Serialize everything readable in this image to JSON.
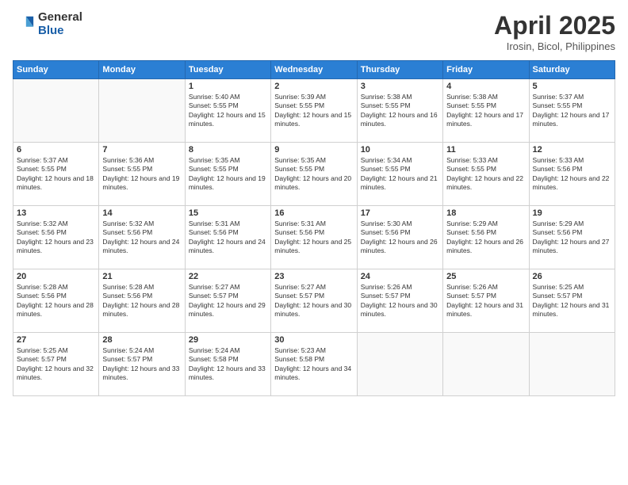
{
  "header": {
    "logo": {
      "general": "General",
      "blue": "Blue"
    },
    "title": "April 2025",
    "location": "Irosin, Bicol, Philippines"
  },
  "weekdays": [
    "Sunday",
    "Monday",
    "Tuesday",
    "Wednesday",
    "Thursday",
    "Friday",
    "Saturday"
  ],
  "weeks": [
    [
      {
        "day": null
      },
      {
        "day": null
      },
      {
        "day": "1",
        "sunrise": "Sunrise: 5:40 AM",
        "sunset": "Sunset: 5:55 PM",
        "daylight": "Daylight: 12 hours and 15 minutes."
      },
      {
        "day": "2",
        "sunrise": "Sunrise: 5:39 AM",
        "sunset": "Sunset: 5:55 PM",
        "daylight": "Daylight: 12 hours and 15 minutes."
      },
      {
        "day": "3",
        "sunrise": "Sunrise: 5:38 AM",
        "sunset": "Sunset: 5:55 PM",
        "daylight": "Daylight: 12 hours and 16 minutes."
      },
      {
        "day": "4",
        "sunrise": "Sunrise: 5:38 AM",
        "sunset": "Sunset: 5:55 PM",
        "daylight": "Daylight: 12 hours and 17 minutes."
      },
      {
        "day": "5",
        "sunrise": "Sunrise: 5:37 AM",
        "sunset": "Sunset: 5:55 PM",
        "daylight": "Daylight: 12 hours and 17 minutes."
      }
    ],
    [
      {
        "day": "6",
        "sunrise": "Sunrise: 5:37 AM",
        "sunset": "Sunset: 5:55 PM",
        "daylight": "Daylight: 12 hours and 18 minutes."
      },
      {
        "day": "7",
        "sunrise": "Sunrise: 5:36 AM",
        "sunset": "Sunset: 5:55 PM",
        "daylight": "Daylight: 12 hours and 19 minutes."
      },
      {
        "day": "8",
        "sunrise": "Sunrise: 5:35 AM",
        "sunset": "Sunset: 5:55 PM",
        "daylight": "Daylight: 12 hours and 19 minutes."
      },
      {
        "day": "9",
        "sunrise": "Sunrise: 5:35 AM",
        "sunset": "Sunset: 5:55 PM",
        "daylight": "Daylight: 12 hours and 20 minutes."
      },
      {
        "day": "10",
        "sunrise": "Sunrise: 5:34 AM",
        "sunset": "Sunset: 5:55 PM",
        "daylight": "Daylight: 12 hours and 21 minutes."
      },
      {
        "day": "11",
        "sunrise": "Sunrise: 5:33 AM",
        "sunset": "Sunset: 5:55 PM",
        "daylight": "Daylight: 12 hours and 22 minutes."
      },
      {
        "day": "12",
        "sunrise": "Sunrise: 5:33 AM",
        "sunset": "Sunset: 5:56 PM",
        "daylight": "Daylight: 12 hours and 22 minutes."
      }
    ],
    [
      {
        "day": "13",
        "sunrise": "Sunrise: 5:32 AM",
        "sunset": "Sunset: 5:56 PM",
        "daylight": "Daylight: 12 hours and 23 minutes."
      },
      {
        "day": "14",
        "sunrise": "Sunrise: 5:32 AM",
        "sunset": "Sunset: 5:56 PM",
        "daylight": "Daylight: 12 hours and 24 minutes."
      },
      {
        "day": "15",
        "sunrise": "Sunrise: 5:31 AM",
        "sunset": "Sunset: 5:56 PM",
        "daylight": "Daylight: 12 hours and 24 minutes."
      },
      {
        "day": "16",
        "sunrise": "Sunrise: 5:31 AM",
        "sunset": "Sunset: 5:56 PM",
        "daylight": "Daylight: 12 hours and 25 minutes."
      },
      {
        "day": "17",
        "sunrise": "Sunrise: 5:30 AM",
        "sunset": "Sunset: 5:56 PM",
        "daylight": "Daylight: 12 hours and 26 minutes."
      },
      {
        "day": "18",
        "sunrise": "Sunrise: 5:29 AM",
        "sunset": "Sunset: 5:56 PM",
        "daylight": "Daylight: 12 hours and 26 minutes."
      },
      {
        "day": "19",
        "sunrise": "Sunrise: 5:29 AM",
        "sunset": "Sunset: 5:56 PM",
        "daylight": "Daylight: 12 hours and 27 minutes."
      }
    ],
    [
      {
        "day": "20",
        "sunrise": "Sunrise: 5:28 AM",
        "sunset": "Sunset: 5:56 PM",
        "daylight": "Daylight: 12 hours and 28 minutes."
      },
      {
        "day": "21",
        "sunrise": "Sunrise: 5:28 AM",
        "sunset": "Sunset: 5:56 PM",
        "daylight": "Daylight: 12 hours and 28 minutes."
      },
      {
        "day": "22",
        "sunrise": "Sunrise: 5:27 AM",
        "sunset": "Sunset: 5:57 PM",
        "daylight": "Daylight: 12 hours and 29 minutes."
      },
      {
        "day": "23",
        "sunrise": "Sunrise: 5:27 AM",
        "sunset": "Sunset: 5:57 PM",
        "daylight": "Daylight: 12 hours and 30 minutes."
      },
      {
        "day": "24",
        "sunrise": "Sunrise: 5:26 AM",
        "sunset": "Sunset: 5:57 PM",
        "daylight": "Daylight: 12 hours and 30 minutes."
      },
      {
        "day": "25",
        "sunrise": "Sunrise: 5:26 AM",
        "sunset": "Sunset: 5:57 PM",
        "daylight": "Daylight: 12 hours and 31 minutes."
      },
      {
        "day": "26",
        "sunrise": "Sunrise: 5:25 AM",
        "sunset": "Sunset: 5:57 PM",
        "daylight": "Daylight: 12 hours and 31 minutes."
      }
    ],
    [
      {
        "day": "27",
        "sunrise": "Sunrise: 5:25 AM",
        "sunset": "Sunset: 5:57 PM",
        "daylight": "Daylight: 12 hours and 32 minutes."
      },
      {
        "day": "28",
        "sunrise": "Sunrise: 5:24 AM",
        "sunset": "Sunset: 5:57 PM",
        "daylight": "Daylight: 12 hours and 33 minutes."
      },
      {
        "day": "29",
        "sunrise": "Sunrise: 5:24 AM",
        "sunset": "Sunset: 5:58 PM",
        "daylight": "Daylight: 12 hours and 33 minutes."
      },
      {
        "day": "30",
        "sunrise": "Sunrise: 5:23 AM",
        "sunset": "Sunset: 5:58 PM",
        "daylight": "Daylight: 12 hours and 34 minutes."
      },
      {
        "day": null
      },
      {
        "day": null
      },
      {
        "day": null
      }
    ]
  ]
}
